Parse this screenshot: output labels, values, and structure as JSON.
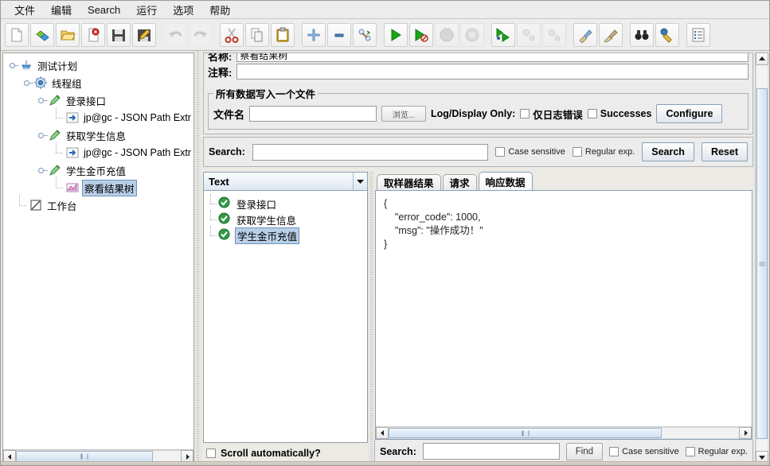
{
  "menubar": {
    "items": [
      {
        "label": "文件",
        "name": "menu-file"
      },
      {
        "label": "编辑",
        "name": "menu-edit"
      },
      {
        "label": "Search",
        "name": "menu-search"
      },
      {
        "label": "运行",
        "name": "menu-run"
      },
      {
        "label": "选项",
        "name": "menu-options"
      },
      {
        "label": "帮助",
        "name": "menu-help"
      }
    ]
  },
  "toolbar": {
    "buttons": [
      {
        "icon": "new-file-icon",
        "enabled": true
      },
      {
        "icon": "templates-icon",
        "enabled": true
      },
      {
        "icon": "open-folder-icon",
        "enabled": true
      },
      {
        "icon": "close-file-icon",
        "enabled": true
      },
      {
        "icon": "save-icon",
        "enabled": true
      },
      {
        "icon": "save-as-icon",
        "enabled": true
      },
      {
        "icon": "undo-icon",
        "enabled": false
      },
      {
        "icon": "redo-icon",
        "enabled": false
      },
      {
        "icon": "cut-icon",
        "enabled": true
      },
      {
        "icon": "copy-icon",
        "enabled": true
      },
      {
        "icon": "paste-icon",
        "enabled": true
      },
      {
        "icon": "expand-all-icon",
        "enabled": true
      },
      {
        "icon": "collapse-all-icon",
        "enabled": true
      },
      {
        "icon": "toggle-icon",
        "enabled": true
      },
      {
        "icon": "start-icon",
        "enabled": true
      },
      {
        "icon": "start-no-pauses-icon",
        "enabled": true
      },
      {
        "icon": "stop-icon",
        "enabled": false
      },
      {
        "icon": "shutdown-icon",
        "enabled": false
      },
      {
        "icon": "remote-start-all-icon",
        "enabled": true
      },
      {
        "icon": "remote-stop-all-icon",
        "enabled": false
      },
      {
        "icon": "remote-shutdown-all-icon",
        "enabled": false
      },
      {
        "icon": "clear-icon",
        "enabled": true
      },
      {
        "icon": "clear-all-icon",
        "enabled": true
      },
      {
        "icon": "search-binoculars-icon",
        "enabled": true
      },
      {
        "icon": "search-reset-icon",
        "enabled": true
      },
      {
        "icon": "function-helper-icon",
        "enabled": true
      }
    ]
  },
  "tree": {
    "nodes": [
      {
        "label": "测试计划",
        "icon": "test-plan-icon",
        "depth": 0,
        "selected": false,
        "name": "tree-node-test-plan"
      },
      {
        "label": "线程组",
        "icon": "thread-group-icon",
        "depth": 1,
        "selected": false,
        "name": "tree-node-thread-group"
      },
      {
        "label": "登录接口",
        "icon": "http-sampler-icon",
        "depth": 2,
        "selected": false,
        "name": "tree-node-login-api"
      },
      {
        "label": "jp@gc - JSON Path Extr",
        "icon": "postprocessor-icon",
        "depth": 3,
        "selected": false,
        "name": "tree-node-json-path-extractor-1"
      },
      {
        "label": "获取学生信息",
        "icon": "http-sampler-icon",
        "depth": 2,
        "selected": false,
        "name": "tree-node-get-student-info"
      },
      {
        "label": "jp@gc - JSON Path Extr",
        "icon": "postprocessor-icon",
        "depth": 3,
        "selected": false,
        "name": "tree-node-json-path-extractor-2"
      },
      {
        "label": "学生金币充值",
        "icon": "http-sampler-icon",
        "depth": 2,
        "selected": false,
        "name": "tree-node-student-coin-recharge"
      },
      {
        "label": "察看结果树",
        "icon": "view-results-tree-icon",
        "depth": 3,
        "selected": true,
        "name": "tree-node-view-results-tree"
      },
      {
        "label": "工作台",
        "icon": "workbench-icon",
        "depth": 0,
        "selected": false,
        "name": "tree-node-workbench"
      }
    ],
    "hscroll": {
      "name": "tree-horizontal-scrollbar"
    }
  },
  "config": {
    "name_label": "名称:",
    "name_value": "察看结果树",
    "comment_label": "注释:",
    "comment_value": "",
    "group_legend": "所有数据写入一个文件",
    "filename_label": "文件名",
    "filename_value": "",
    "browse_label": "浏览...",
    "logdisplay_label": "Log/Display Only:",
    "errors_only_label": "仅日志错误",
    "successes_label": "Successes",
    "configure_label": "Configure"
  },
  "search_panel": {
    "label": "Search:",
    "value": "",
    "case_sensitive_label": "Case sensitive",
    "regular_exp_label": "Regular exp.",
    "search_button": "Search",
    "reset_button": "Reset"
  },
  "results": {
    "render_selected": "Text",
    "items": [
      {
        "label": "登录接口",
        "status": "success",
        "selected": false,
        "name": "result-item-login-api"
      },
      {
        "label": "获取学生信息",
        "status": "success",
        "selected": false,
        "name": "result-item-get-student-info"
      },
      {
        "label": "学生金币充值",
        "status": "success",
        "selected": true,
        "name": "result-item-student-coin-recharge"
      }
    ],
    "scroll_automatically_label": "Scroll automatically?"
  },
  "detail": {
    "tabs": [
      {
        "label": "取样器结果",
        "active": false,
        "name": "tab-sampler-result"
      },
      {
        "label": "请求",
        "active": false,
        "name": "tab-request"
      },
      {
        "label": "响应数据",
        "active": true,
        "name": "tab-response-data"
      }
    ],
    "response_body": "{\n    \"error_code\": 1000,\n    \"msg\": \"操作成功！\"\n}",
    "find_label": "Search:",
    "find_value": "",
    "find_button": "Find",
    "case_sensitive_label": "Case sensitive",
    "regular_exp_label": "Regular exp."
  },
  "colors": {
    "accent": "#b9cfe7",
    "panel_bg": "#ececec",
    "success_green": "#2f9e44",
    "window_bg": "#d6d2c8"
  }
}
